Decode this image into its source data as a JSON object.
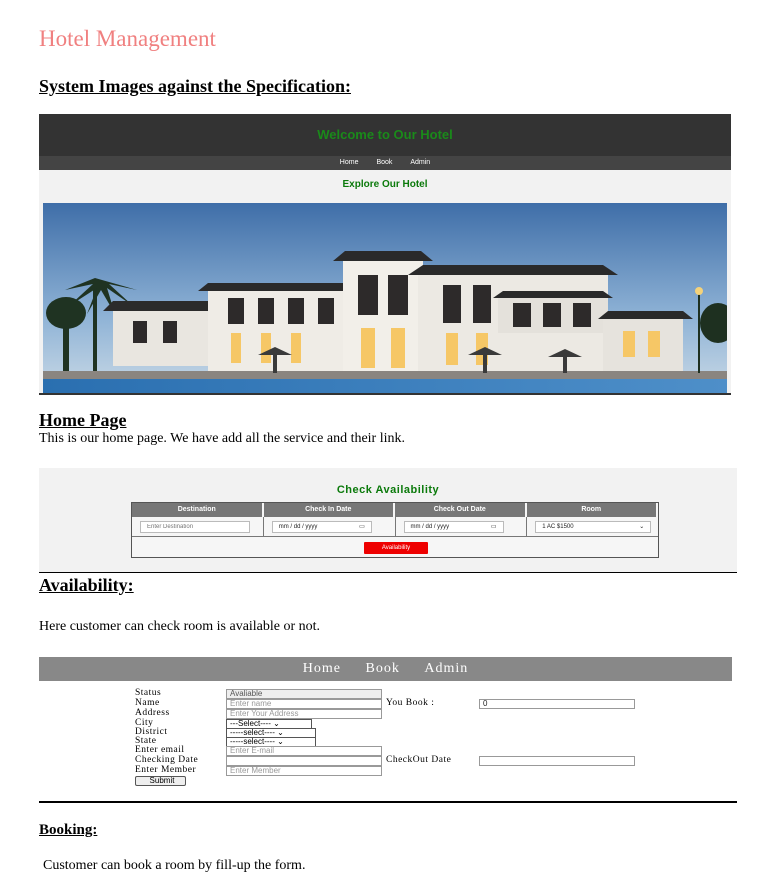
{
  "doc": {
    "title": "Hotel Management",
    "heading1": "System Images against the Specification:",
    "heading_home": "Home Page",
    "home_text": "This is our home page. We have add all the service and their link.",
    "heading_avail": "Availability:",
    "avail_text": "Here customer can check room is available or not.",
    "heading_booking": "Booking:",
    "booking_text": "Customer can book a room by fill-up the form."
  },
  "home_shot": {
    "title": "Welcome to Our Hotel",
    "nav": [
      "Home",
      "Book",
      "Admin"
    ],
    "subtitle": "Explore Our Hotel"
  },
  "avail_shot": {
    "title": "Check Availability",
    "columns": [
      "Destination",
      "Check In Date",
      "Check Out Date",
      "Room"
    ],
    "destination_placeholder": "Enter Destination",
    "checkin_value": "mm / dd / yyyy",
    "checkout_value": "mm / dd / yyyy",
    "room_value": "1 AC $1500",
    "button": "Availability"
  },
  "booking_shot": {
    "nav": [
      "Home",
      "Book",
      "Admin"
    ],
    "status_label": "Status",
    "status_value": "Avaliable",
    "name_label": "Name",
    "name_placeholder": "Enter name",
    "youbook_label": "You Book :",
    "youbook_value": "0",
    "address_label": "Address",
    "address_placeholder": "Enter Your Address",
    "city_label": "City",
    "city_value": "---Select----",
    "district_label": "District",
    "district_value": "-----select----",
    "state_label": "State",
    "state_value": "-----select----",
    "email_label": "Enter email",
    "email_placeholder": "Enter E-mail",
    "checkin_label": "Checking Date",
    "checkout_label": "CheckOut Date",
    "member_label": "Enter Member",
    "member_placeholder": "Enter Member",
    "submit": "Submit"
  }
}
